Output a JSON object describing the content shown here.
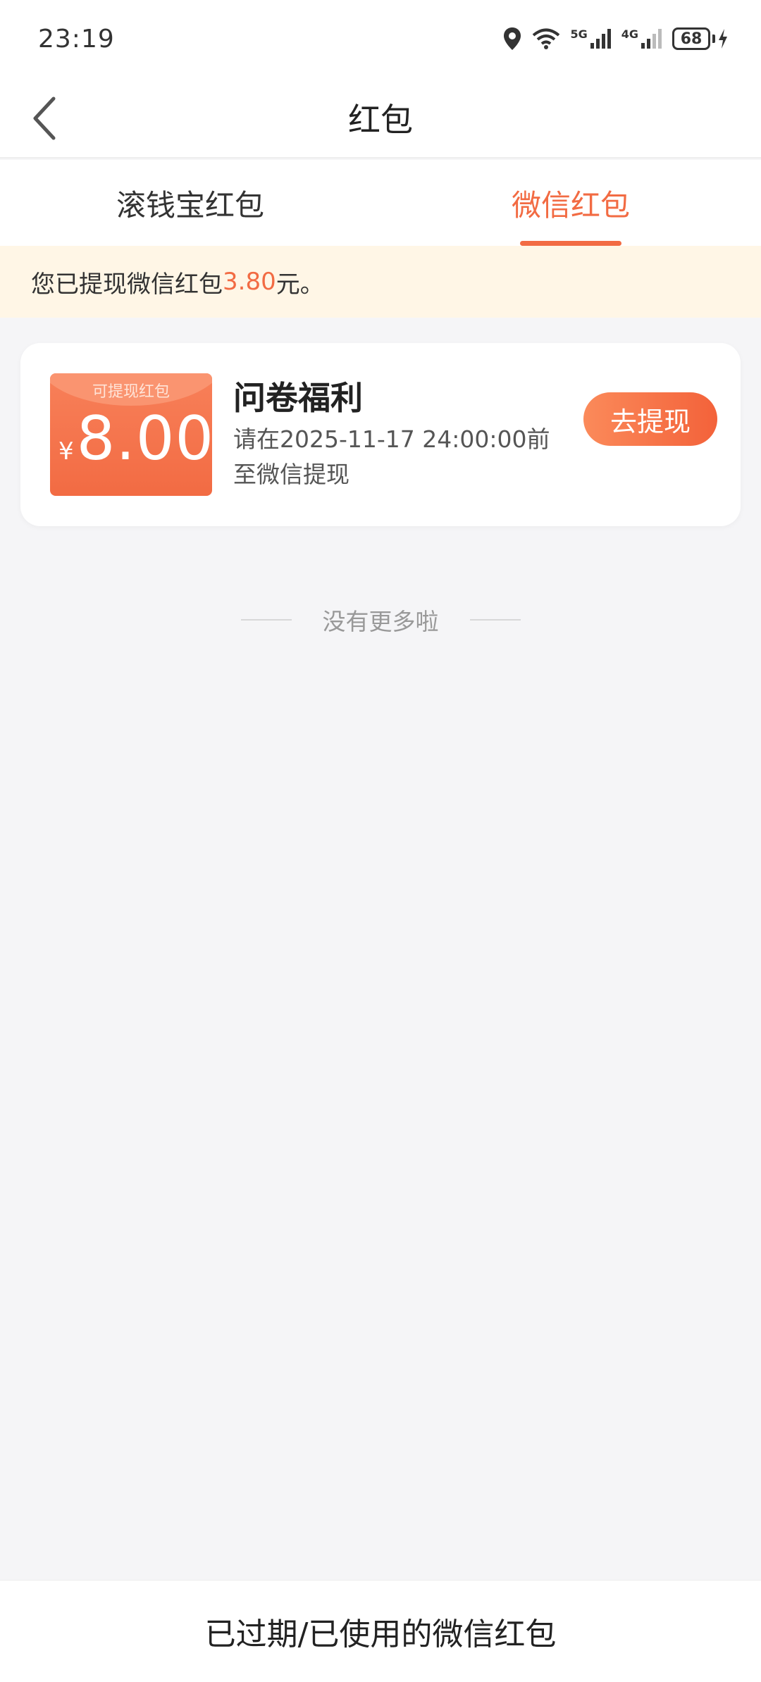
{
  "status_bar": {
    "time": "23:19",
    "network_5g": "5G",
    "network_4g": "4G",
    "battery_level": "68"
  },
  "nav": {
    "title": "红包",
    "back_icon": "chevron-left-icon"
  },
  "tabs": [
    {
      "label": "滚钱宝红包",
      "active": false
    },
    {
      "label": "微信红包",
      "active": true
    }
  ],
  "notice": {
    "prefix": "您已提现微信红包",
    "amount": "3.80",
    "suffix": "元。"
  },
  "card": {
    "coupon_label": "可提现红包",
    "currency": "¥",
    "amount": "8.00",
    "title": "问卷福利",
    "desc": "请在2025-11-17 24:00:00前至微信提现",
    "button_label": "去提现"
  },
  "list_end": "没有更多啦",
  "bottom_bar": {
    "label": "已过期/已使用的微信红包"
  },
  "colors": {
    "accent": "#f26b43",
    "notice_bg": "#fff6e6",
    "page_bg": "#f5f5f7"
  }
}
